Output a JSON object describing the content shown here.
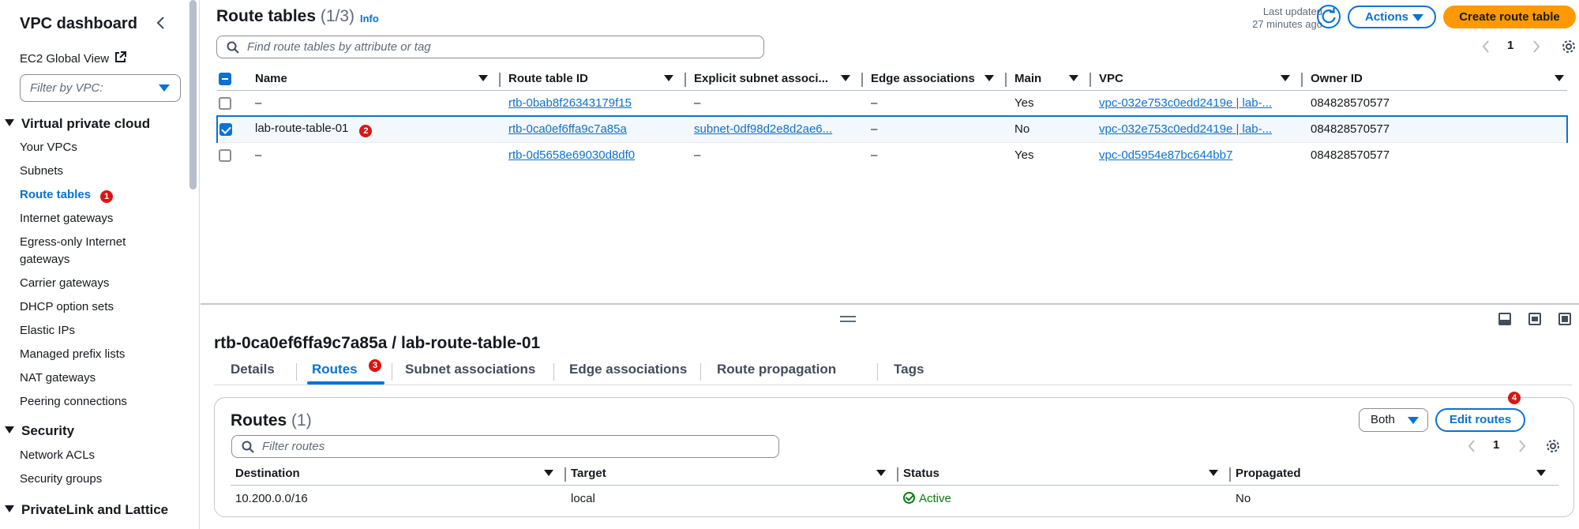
{
  "sidebar": {
    "title": "VPC dashboard",
    "ec2_global_view": "EC2 Global View",
    "filter_placeholder": "Filter by VPC:",
    "section_vpc": "Virtual private cloud",
    "items_vpc": [
      "Your VPCs",
      "Subnets",
      "Route tables",
      "Internet gateways",
      "Egress-only Internet",
      "gateways",
      "Carrier gateways",
      "DHCP option sets",
      "Elastic IPs",
      "Managed prefix lists",
      "NAT gateways",
      "Peering connections"
    ],
    "active_badge": "1",
    "section_security": "Security",
    "items_security": [
      "Network ACLs",
      "Security groups"
    ],
    "section_privatelink": "PrivateLink and Lattice"
  },
  "header": {
    "title": "Route tables",
    "count": "(1/3)",
    "info": "Info",
    "last_updated_line1": "Last updated",
    "last_updated_line2": "27 minutes ago",
    "actions_label": "Actions",
    "create_label": "Create route table",
    "search_placeholder": "Find route tables by attribute or tag",
    "page": "1"
  },
  "route_tables": {
    "columns": [
      "Name",
      "Route table ID",
      "Explicit subnet associ...",
      "Edge associations",
      "Main",
      "VPC",
      "Owner ID"
    ],
    "rows": [
      {
        "name": "–",
        "id": "rtb-0bab8f26343179f15",
        "subnet": "–",
        "edge": "–",
        "main": "Yes",
        "vpc": "vpc-032e753c0edd2419e | lab-...",
        "owner": "084828570577",
        "selected": false
      },
      {
        "name": "lab-route-table-01",
        "badge": "2",
        "id": "rtb-0ca0ef6ffa9c7a85a",
        "subnet": "subnet-0df98d2e8d2ae6...",
        "edge": "–",
        "main": "No",
        "vpc": "vpc-032e753c0edd2419e | lab-...",
        "owner": "084828570577",
        "selected": true
      },
      {
        "name": "–",
        "id": "rtb-0d5658e69030d8df0",
        "subnet": "–",
        "edge": "–",
        "main": "Yes",
        "vpc": "vpc-0d5954e87bc644bb7",
        "owner": "084828570577",
        "selected": false
      }
    ]
  },
  "detail": {
    "title": "rtb-0ca0ef6ffa9c7a85a / lab-route-table-01",
    "tabs": [
      "Details",
      "Routes",
      "Subnet associations",
      "Edge associations",
      "Route propagation",
      "Tags"
    ],
    "routes_badge": "3",
    "edit_badge": "4",
    "routes_title": "Routes",
    "routes_count": "(1)",
    "both_label": "Both",
    "edit_routes_label": "Edit routes",
    "filter_placeholder": "Filter routes",
    "page": "1",
    "columns": [
      "Destination",
      "Target",
      "Status",
      "Propagated"
    ],
    "rows": [
      {
        "destination": "10.200.0.0/16",
        "target": "local",
        "status": "Active",
        "propagated": "No"
      }
    ]
  },
  "colors": {
    "accent": "#0972d3",
    "primary_button": "#ff9900",
    "success": "#037f0c",
    "badge": "#d91515"
  }
}
